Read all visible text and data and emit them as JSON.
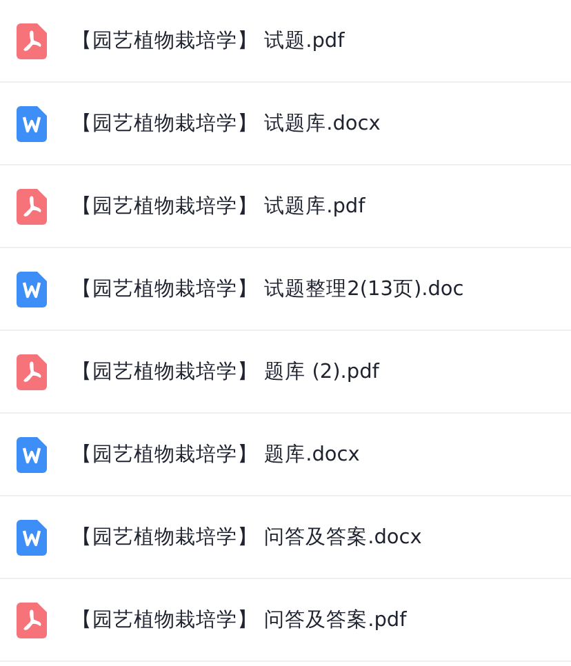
{
  "files": [
    {
      "kind": "pdf",
      "name": "【园艺植物栽培学】 试题.pdf"
    },
    {
      "kind": "word",
      "name": "【园艺植物栽培学】 试题库.docx"
    },
    {
      "kind": "pdf",
      "name": "【园艺植物栽培学】 试题库.pdf"
    },
    {
      "kind": "word",
      "name": "【园艺植物栽培学】 试题整理2(13页).doc"
    },
    {
      "kind": "pdf",
      "name": "【园艺植物栽培学】 题库 (2).pdf"
    },
    {
      "kind": "word",
      "name": "【园艺植物栽培学】 题库.docx"
    },
    {
      "kind": "word",
      "name": "【园艺植物栽培学】 问答及答案.docx"
    },
    {
      "kind": "pdf",
      "name": "【园艺植物栽培学】 问答及答案.pdf"
    }
  ]
}
